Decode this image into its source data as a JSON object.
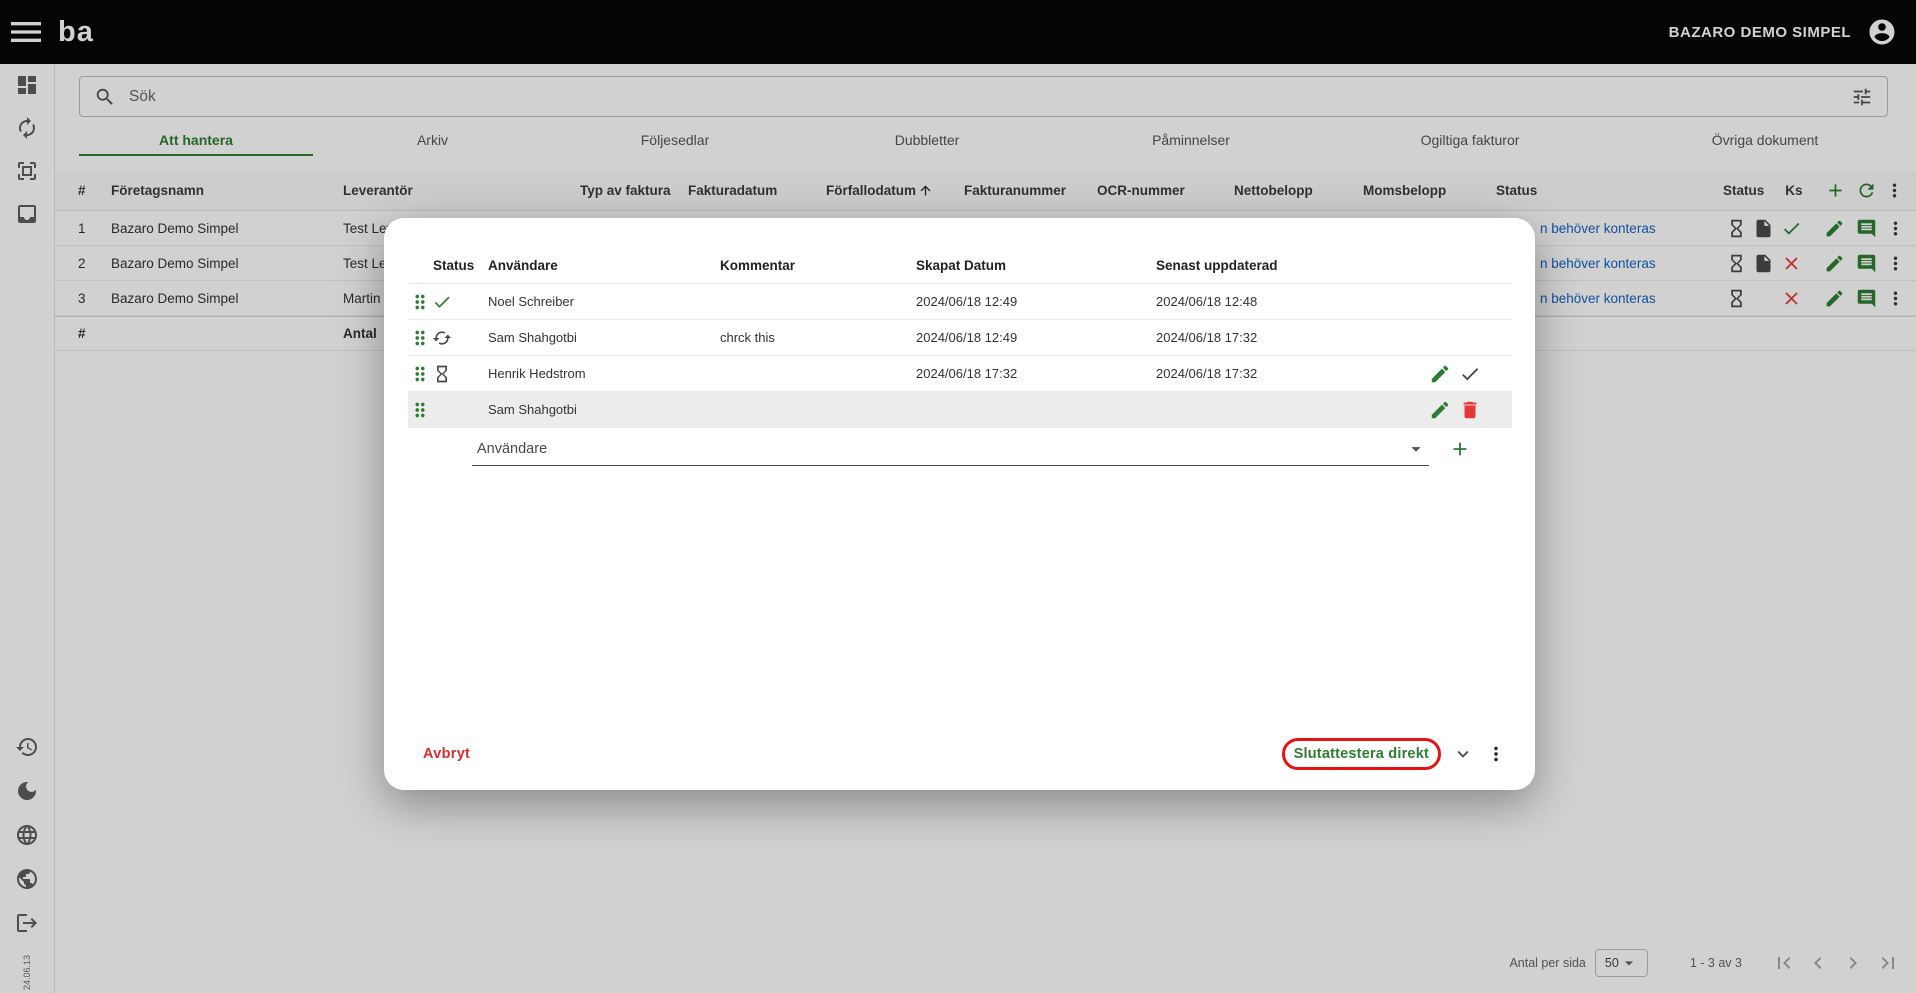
{
  "topbar": {
    "brand": "ba",
    "account_name": "BAZARO DEMO SIMPEL"
  },
  "search": {
    "placeholder": "Sök"
  },
  "tabs": {
    "active": "Att hantera",
    "items": [
      {
        "label": "Att hantera"
      },
      {
        "label": "Arkiv"
      },
      {
        "label": "Följesedlar"
      },
      {
        "label": "Dubbletter"
      },
      {
        "label": "Påminnelser"
      },
      {
        "label": "Ogiltiga fakturor"
      },
      {
        "label": "Övriga dokument"
      }
    ]
  },
  "invoice_table": {
    "headers": {
      "num": "#",
      "company": "Företagsnamn",
      "supplier": "Leverantör",
      "type": "Typ av faktura",
      "invoice_date": "Fakturadatum",
      "due_date": "Förfallodatum",
      "invoice_number": "Fakturanummer",
      "ocr": "OCR-nummer",
      "net": "Nettobelopp",
      "vat": "Momsbelopp",
      "status": "Status",
      "status2": "Status",
      "ks": "Ks"
    },
    "rows": [
      {
        "num": "1",
        "company": "Bazaro Demo Simpel",
        "supplier": "Test Lev",
        "status_link": "n behöver konteras"
      },
      {
        "num": "2",
        "company": "Bazaro Demo Simpel",
        "supplier": "Test Lev",
        "status_link": "n behöver konteras"
      },
      {
        "num": "3",
        "company": "Bazaro Demo Simpel",
        "supplier": "Martin &",
        "status_link": "n behöver konteras"
      }
    ],
    "summary": {
      "num": "#",
      "label": "Antal"
    }
  },
  "pagination": {
    "per_page_label": "Antal per sida",
    "per_page_value": "50",
    "range": "1 - 3 av 3"
  },
  "version": "24.06.13",
  "modal": {
    "headers": {
      "status": "Status",
      "user": "Användare",
      "comment": "Kommentar",
      "created": "Skapat Datum",
      "updated": "Senast uppdaterad"
    },
    "rows": [
      {
        "user": "Noel Schreiber",
        "comment": "",
        "created": "2024/06/18 12:49",
        "updated": "2024/06/18 12:48"
      },
      {
        "user": "Sam Shahgotbi",
        "comment": "chrck this",
        "created": "2024/06/18 12:49",
        "updated": "2024/06/18 17:32"
      },
      {
        "user": "Henrik Hedstrom",
        "comment": "",
        "created": "2024/06/18 17:32",
        "updated": "2024/06/18 17:32"
      },
      {
        "user": "Sam Shahgotbi",
        "comment": "",
        "created": "",
        "updated": ""
      }
    ],
    "user_select_label": "Användare",
    "cancel_label": "Avbryt",
    "approve_label": "Slutattestera direkt"
  },
  "colors": {
    "accent_green": "#2e7d32",
    "danger_red": "#d32f2f",
    "link_blue": "#1565c0",
    "annotation_red": "#e81212",
    "topbar_black": "#070707"
  },
  "icons": {
    "menu-icon": "menu",
    "search-icon": "search",
    "filter-icon": "tune",
    "account-icon": "account",
    "dashboard-icon": "dashboard",
    "sync-icon": "autorenew",
    "scanner-icon": "scanner",
    "inbox-icon": "inbox",
    "history-icon": "history",
    "dark-mode-icon": "moon",
    "language-icon": "globe",
    "world-icon": "public",
    "logout-icon": "logout",
    "add-icon": "plus",
    "refresh-icon": "refresh",
    "hourglass-icon": "hourglass",
    "file-icon": "file",
    "check-icon": "check",
    "close-icon": "close",
    "edit-icon": "edit",
    "comment-icon": "comment",
    "kebab-icon": "more",
    "drag-icon": "drag",
    "swap-icon": "cached",
    "delete-icon": "delete",
    "sort-up-icon": "arrowup",
    "dropdown-icon": "dropdown",
    "chevron-down-icon": "expand",
    "first-page-icon": "firstpage",
    "prev-page-icon": "chevleft",
    "next-page-icon": "chevright",
    "last-page-icon": "lastpage"
  }
}
